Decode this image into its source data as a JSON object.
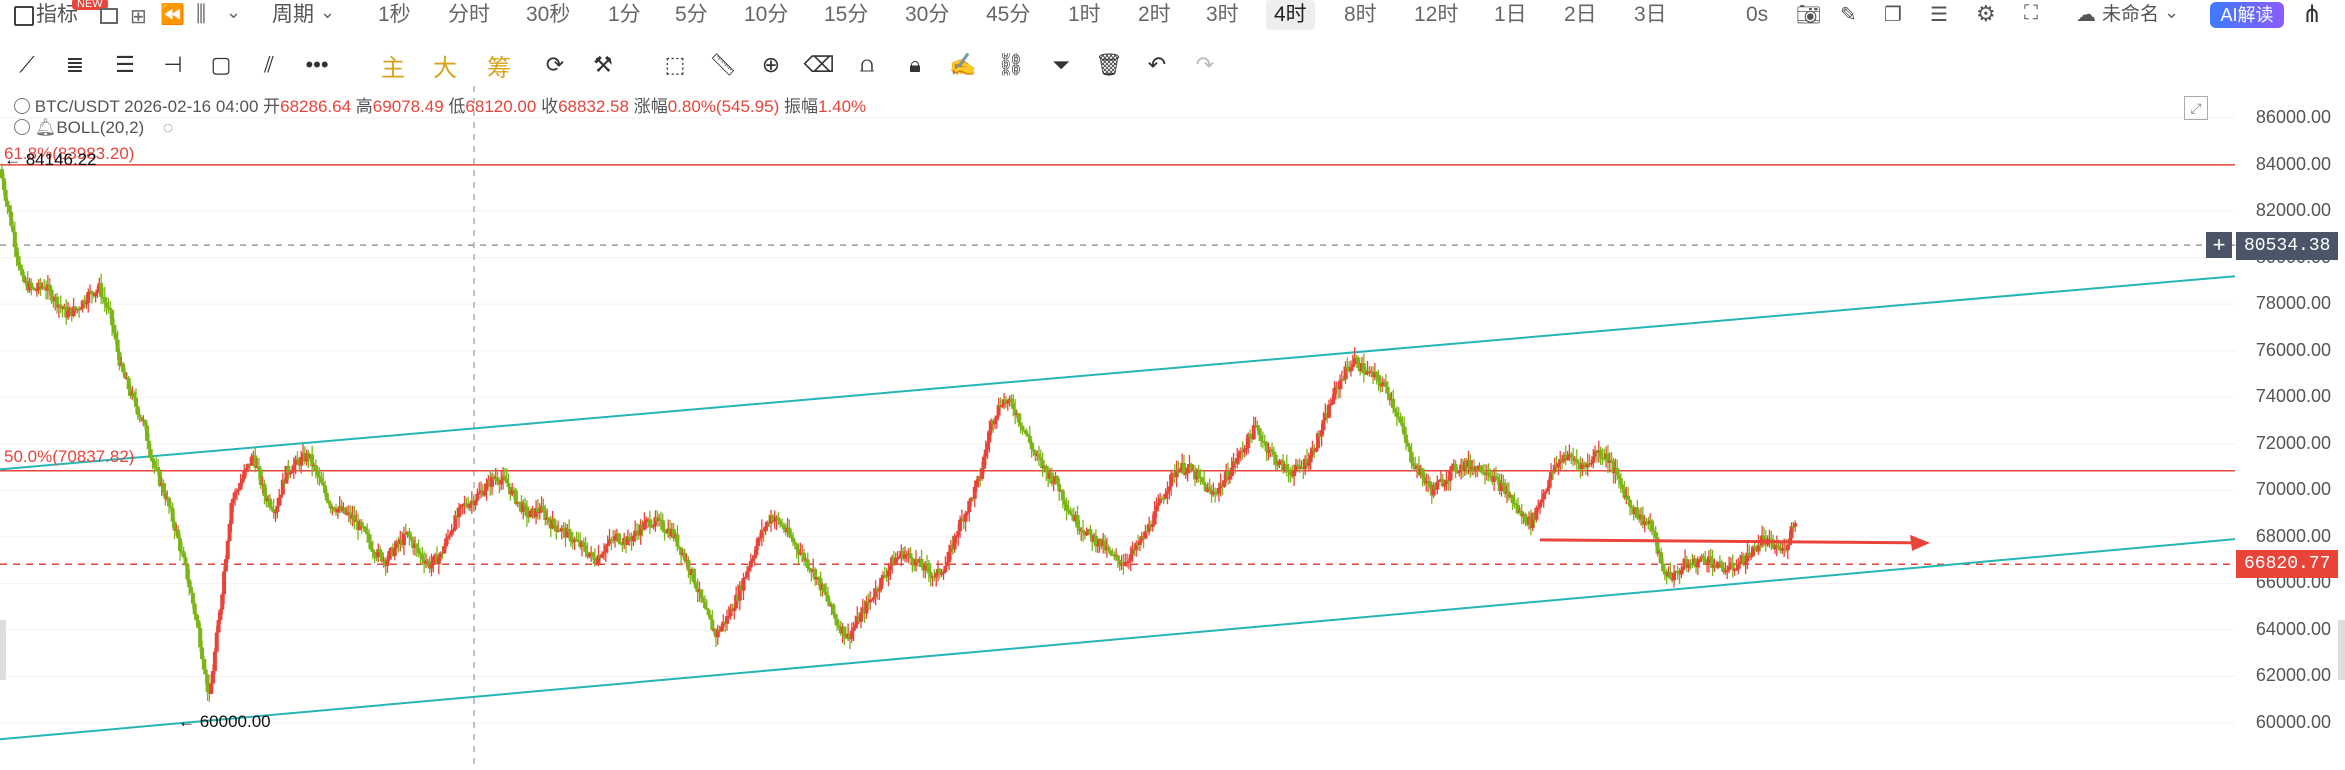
{
  "topbar": {
    "indicator_label": "指标",
    "new_badge": "NEW",
    "period_label": "周期",
    "intervals": [
      "1秒",
      "分时",
      "30秒",
      "1分",
      "5分",
      "10分",
      "15分",
      "30分",
      "45分",
      "1时",
      "2时",
      "3时",
      "4时",
      "8时",
      "12时",
      "1日",
      "2日",
      "3日"
    ],
    "active_interval": "4时",
    "countdown": "0s",
    "layout_name": "未命名",
    "ai_label": "AI解读"
  },
  "toolbar": {
    "main_label": "主",
    "big_label": "大",
    "chip_label": "筹"
  },
  "info": {
    "symbol": "BTC/USDT",
    "datetime": "2026-02-16 04:00",
    "open_label": "开",
    "open": "68286.64",
    "high_label": "高",
    "high": "69078.49",
    "low_label": "低",
    "low": "68120.00",
    "close_label": "收",
    "close": "68832.58",
    "change_label": "涨幅",
    "change": "0.80%(545.95)",
    "amplitude_label": "振幅",
    "amplitude": "1.40%",
    "boll": "BOLL(20,2)"
  },
  "annotations": {
    "fib_618": "61.8%(83983.20)",
    "fib_50": "50.0%(70837.82)",
    "high_mark": "← 84146.22",
    "low_mark": "← 60000.00"
  },
  "price_scale": {
    "ticks": [
      "86000.00",
      "84000.00",
      "82000.00",
      "80000.00",
      "78000.00",
      "76000.00",
      "74000.00",
      "72000.00",
      "70000.00",
      "68000.00",
      "66000.00",
      "64000.00",
      "62000.00",
      "60000.00"
    ],
    "crosshair_price": "80534.38",
    "current_price": "66820.77"
  },
  "chart_data": {
    "type": "candlestick",
    "y_range": [
      59500,
      86800
    ],
    "fib_levels": [
      {
        "label": "61.8%",
        "price": 83983.2
      },
      {
        "label": "50.0%",
        "price": 70837.82
      }
    ],
    "channel_upper": [
      {
        "x": 0.0,
        "price": 70900
      },
      {
        "x": 1.0,
        "price": 79200
      }
    ],
    "channel_lower": [
      {
        "x": 0.0,
        "price": 59300
      },
      {
        "x": 1.0,
        "price": 67900
      }
    ],
    "close_path": [
      83800,
      81500,
      79000,
      78600,
      78800,
      78200,
      77600,
      77800,
      78400,
      78700,
      77500,
      75200,
      74000,
      72900,
      71000,
      69800,
      68200,
      66300,
      64000,
      61000,
      65000,
      69500,
      70500,
      71500,
      69800,
      69200,
      70800,
      71200,
      71500,
      70400,
      69400,
      69100,
      68800,
      68200,
      67400,
      67000,
      67600,
      68100,
      67300,
      66800,
      67200,
      68400,
      69300,
      69600,
      70100,
      70600,
      70300,
      69500,
      68900,
      69200,
      68600,
      68300,
      67900,
      67500,
      67000,
      67600,
      68000,
      67800,
      68300,
      68700,
      68500,
      68200,
      67300,
      66200,
      64800,
      63800,
      64500,
      65500,
      66800,
      68000,
      68900,
      68500,
      67800,
      67100,
      66400,
      65400,
      64300,
      63700,
      64500,
      65300,
      66100,
      66900,
      67300,
      67000,
      66600,
      66300,
      66900,
      68400,
      69400,
      70600,
      72900,
      73900,
      73600,
      72600,
      71500,
      70800,
      70300,
      69200,
      68500,
      68000,
      67700,
      67100,
      66900,
      67400,
      68100,
      69100,
      70200,
      71000,
      70900,
      70400,
      69800,
      70300,
      71100,
      71900,
      72700,
      71900,
      71200,
      70800,
      70900,
      71500,
      72600,
      74000,
      75000,
      75600,
      75100,
      74800,
      74300,
      73100,
      71500,
      70700,
      70000,
      70400,
      70900,
      71100,
      71000,
      70900,
      70300,
      69800,
      69000,
      68600,
      69700,
      70800,
      71500,
      71300,
      71000,
      71700,
      71400,
      70400,
      69400,
      68800,
      68400,
      66500,
      66300,
      66800,
      66900,
      67100,
      66700,
      66600,
      66900,
      67300,
      67900,
      67600,
      67400,
      68800
    ]
  }
}
